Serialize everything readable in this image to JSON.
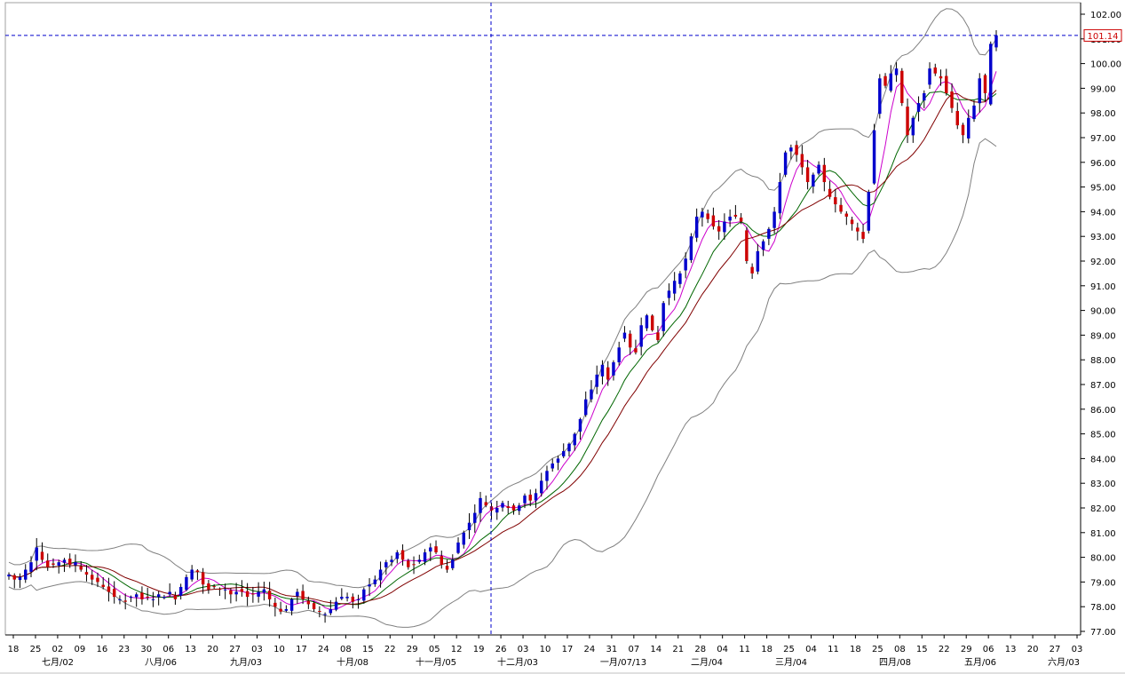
{
  "chart_data": {
    "type": "candlestick",
    "title": "",
    "xlabel": "",
    "ylabel": "",
    "ylim": [
      77.0,
      102.0
    ],
    "y_ticks": [
      "77.00",
      "78.00",
      "79.00",
      "80.00",
      "81.00",
      "82.00",
      "83.00",
      "84.00",
      "85.00",
      "86.00",
      "87.00",
      "88.00",
      "89.00",
      "90.00",
      "91.00",
      "92.00",
      "93.00",
      "94.00",
      "95.00",
      "96.00",
      "97.00",
      "98.00",
      "99.00",
      "100.00",
      "101.00",
      "102.00"
    ],
    "x_ticks": [
      "18",
      "25",
      "02",
      "09",
      "16",
      "23",
      "30",
      "06",
      "13",
      "20",
      "27",
      "03",
      "10",
      "17",
      "24",
      "08",
      "15",
      "22",
      "29",
      "05",
      "12",
      "19",
      "26",
      "03",
      "10",
      "17",
      "24",
      "31",
      "07",
      "14",
      "21",
      "28",
      "04",
      "11",
      "18",
      "25",
      "04",
      "11",
      "18",
      "25",
      "08",
      "15",
      "22",
      "29",
      "06",
      "13",
      "20",
      "27",
      "03"
    ],
    "months": [
      "七月/02",
      "八月/06",
      "九月/03",
      "十月/08",
      "十一月/05",
      "十二月/03",
      "一月/07/13",
      "二月/04",
      "三月/04",
      "四月/08",
      "五月/06",
      "六月/03"
    ],
    "last_price": "101.14",
    "crosshair_price": 101.14,
    "colors": {
      "up": "#0000cc",
      "down": "#cc0000",
      "ma_short": "#cc00cc",
      "ma_mid": "#006600",
      "ma_long": "#800000",
      "bands": "#808080",
      "crosshair": "#0000cc"
    },
    "series": [
      {
        "name": "",
        "type": "candles",
        "closes": [
          79.3,
          79.1,
          79.2,
          79.5,
          79.8,
          80.4,
          79.9,
          79.6,
          79.7,
          79.8,
          79.9,
          79.7,
          79.8,
          79.5,
          79.3,
          79.1,
          79.0,
          78.8,
          78.6,
          78.4,
          78.3,
          78.2,
          78.4,
          78.5,
          78.3,
          78.4,
          78.3,
          78.5,
          78.4,
          78.6,
          78.3,
          78.8,
          79.2,
          79.5,
          79.4,
          78.9,
          78.7,
          78.8,
          78.7,
          78.7,
          78.5,
          78.6,
          78.6,
          78.4,
          78.5,
          78.6,
          78.7,
          78.3,
          78.0,
          77.8,
          77.9,
          78.3,
          78.6,
          78.3,
          78.1,
          77.9,
          77.8,
          77.7,
          77.9,
          78.2,
          78.4,
          78.4,
          78.2,
          78.3,
          78.7,
          78.9,
          79.1,
          79.5,
          79.8,
          79.9,
          80.2,
          79.9,
          79.6,
          79.7,
          79.9,
          80.2,
          80.4,
          80.2,
          79.7,
          79.5,
          79.9,
          80.6,
          81.0,
          81.4,
          81.8,
          82.4,
          82.1,
          81.9,
          82.0,
          82.2,
          82.0,
          81.9,
          82.1,
          82.5,
          82.3,
          82.6,
          83.1,
          83.5,
          83.8,
          84.0,
          84.3,
          84.6,
          85.0,
          85.6,
          86.4,
          86.8,
          87.4,
          87.8,
          87.2,
          87.9,
          88.5,
          89.1,
          88.5,
          88.3,
          89.4,
          89.8,
          89.2,
          88.8,
          90.3,
          90.8,
          91.2,
          91.5,
          92.1,
          93.0,
          93.8,
          94.0,
          93.7,
          93.4,
          93.2,
          93.6,
          93.8,
          93.8,
          93.6,
          92.0,
          91.5,
          92.4,
          92.8,
          93.3,
          94.0,
          95.2,
          96.4,
          96.6,
          96.3,
          95.8,
          95.2,
          95.5,
          95.9,
          95.2,
          94.6,
          94.3,
          94.0,
          93.8,
          93.5,
          93.2,
          92.9,
          94.8,
          97.3,
          99.4,
          99.1,
          99.6,
          99.8,
          98.4,
          97.1,
          97.8,
          98.4,
          98.8,
          99.8,
          99.6,
          99.4,
          98.8,
          98.2,
          97.5,
          97.1,
          97.8,
          98.3,
          99.4,
          98.8,
          100.8,
          101.14
        ]
      },
      {
        "name": "",
        "type": "moving_average"
      },
      {
        "name": "",
        "type": "moving_average"
      },
      {
        "name": "",
        "type": "moving_average"
      },
      {
        "name": "",
        "type": "bollinger_bands"
      }
    ],
    "grid": false,
    "legend": "none"
  }
}
